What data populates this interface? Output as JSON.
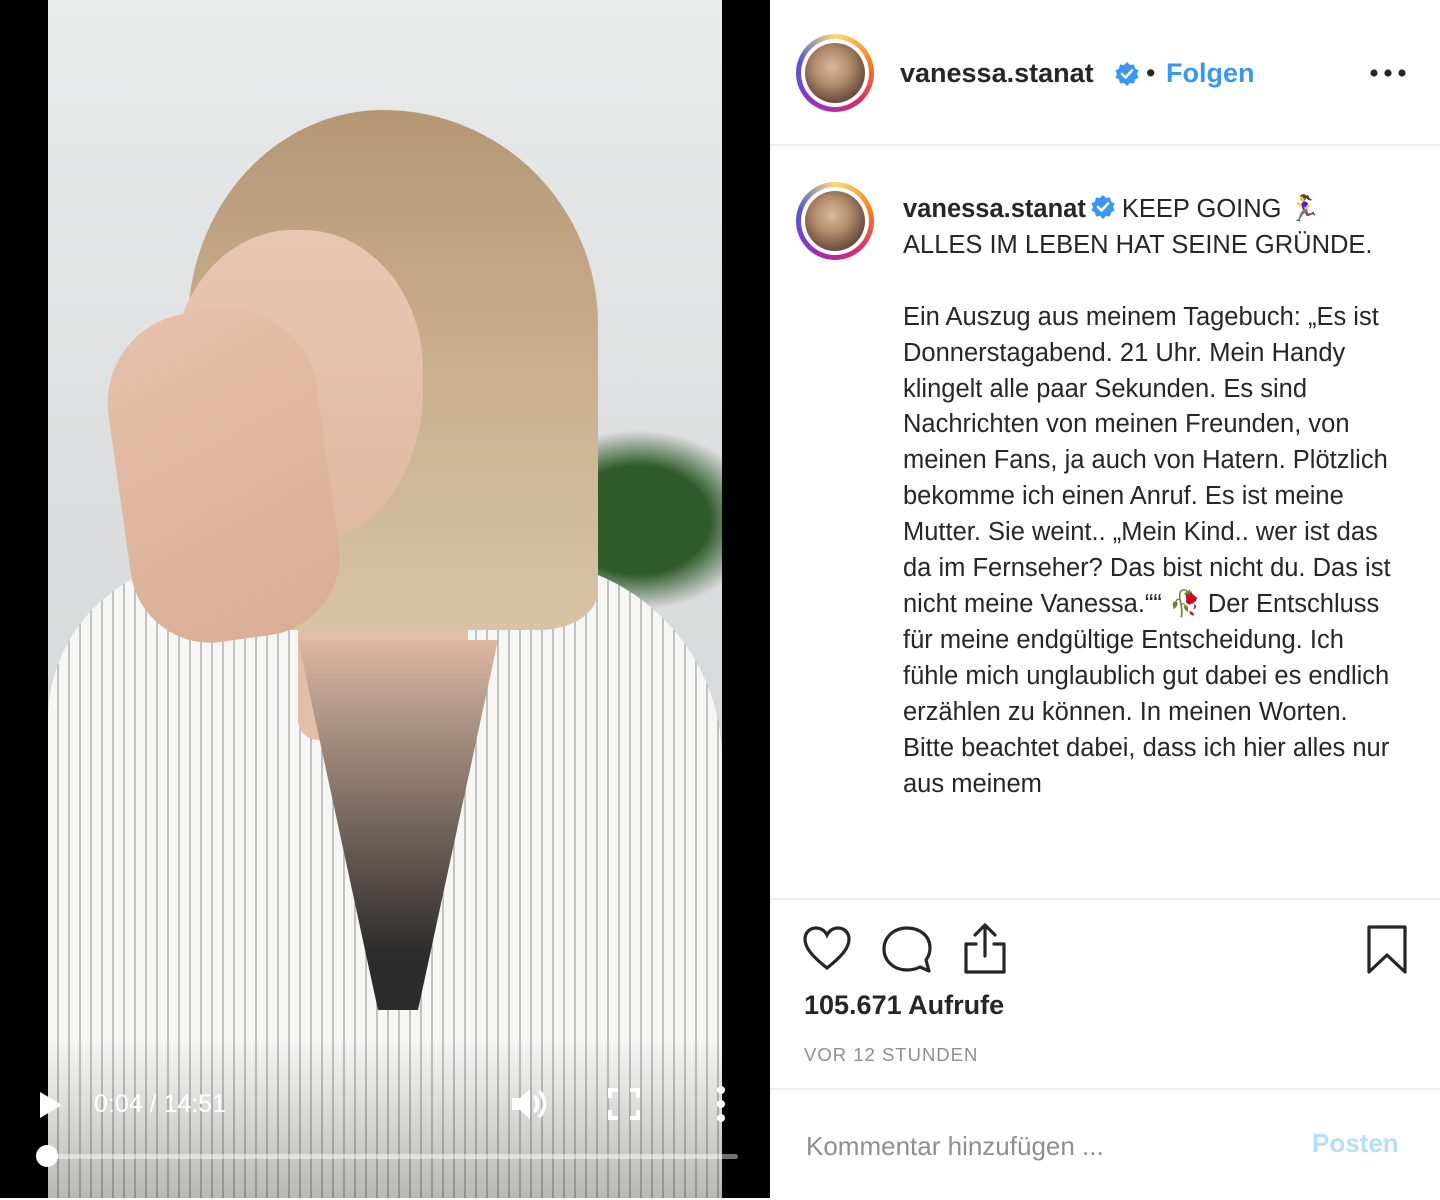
{
  "video": {
    "current_time": "0:04",
    "duration": "14:51",
    "time_display": "0:04 / 14:51",
    "progress_fraction": 0.005
  },
  "post": {
    "username": "vanessa.stanat",
    "follow_label": "Folgen",
    "separator": "•",
    "caption_title": "KEEP GOING 🏃‍♀️ ALLES IM LEBEN HAT SEINE GRÜNDE.",
    "caption_body": "Ein Auszug aus meinem Tagebuch: „Es ist Donnerstagabend. 21 Uhr. Mein Handy klingelt alle paar Sekunden. Es sind Nachrichten von meinen Freunden, von meinen Fans, ja auch von Hatern. Plötzlich bekomme ich einen Anruf. Es ist meine Mutter. Sie weint.. „Mein Kind.. wer ist das da im Fernseher? Das bist nicht du. Das ist nicht meine Vanessa.““ 🥀 Der Entschluss für meine endgültige Entscheidung. Ich fühle mich unglaublich gut dabei es endlich erzählen zu können. In meinen Worten. Bitte beachtet dabei, dass ich hier alles nur aus meinem",
    "views": "105.671 Aufrufe",
    "timestamp": "VOR 12 STUNDEN"
  },
  "comment": {
    "placeholder": "Kommentar hinzufügen ...",
    "post_label": "Posten"
  },
  "colors": {
    "link_blue": "#3897f0",
    "verified_blue": "#3897f0",
    "post_disabled": "#b2dffc",
    "muted": "#8e8e8e",
    "divider": "#efefef"
  },
  "icons": {
    "play": "play-icon",
    "volume": "volume-icon",
    "fullscreen": "fullscreen-icon",
    "video_more": "vertical-dots-icon",
    "post_more": "horizontal-dots-icon",
    "verified": "verified-badge-icon",
    "like": "heart-icon",
    "comment": "comment-bubble-icon",
    "share": "share-icon",
    "save": "bookmark-icon"
  }
}
